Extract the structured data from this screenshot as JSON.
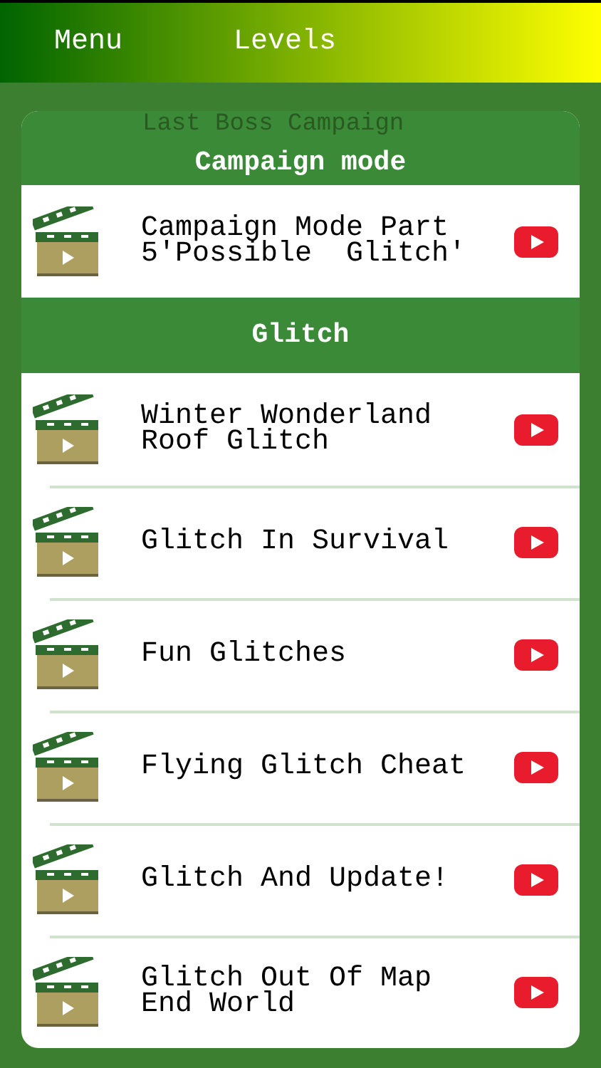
{
  "header": {
    "menu": "Menu",
    "title": "Levels"
  },
  "hidden_row": {
    "title": "Last Boss Campaign"
  },
  "sections": [
    {
      "title": "Campaign mode",
      "items": [
        {
          "title": "Campaign Mode Part 5'Possible  Glitch'"
        }
      ]
    },
    {
      "title": "Glitch",
      "items": [
        {
          "title": "Winter Wonderland Roof Glitch"
        },
        {
          "title": "Glitch In Survival"
        },
        {
          "title": "Fun Glitches"
        },
        {
          "title": "Flying Glitch Cheat"
        },
        {
          "title": "Glitch And Update!"
        },
        {
          "title": "Glitch Out Of Map End World"
        }
      ]
    }
  ]
}
